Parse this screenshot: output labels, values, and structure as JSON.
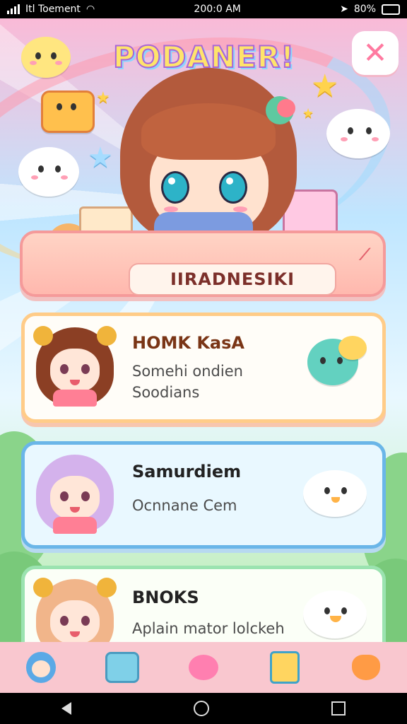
{
  "status_bar": {
    "carrier": "Itl Toement",
    "time": "200:0 AM",
    "battery": "80%"
  },
  "header": {
    "app_title": "PODANER",
    "title_exclaim": "!",
    "close_icon": "close-icon"
  },
  "banner": {
    "label": "IIRADNESIKI"
  },
  "cards": [
    {
      "title": "HOMK KasA",
      "lines": [
        "Somehi ondien",
        "Soodians"
      ],
      "title_color": "#7a3516",
      "avatar_hair": "#8b3f24"
    },
    {
      "title": "Samurdiem",
      "lines": [
        "Ocnnane Cem"
      ],
      "title_color": "#222222",
      "avatar_hair": "#d4b2ec"
    },
    {
      "title": "BNOKS",
      "lines": [
        "Aplain mator lolckeh"
      ],
      "title_color": "#222222",
      "avatar_hair": "#f1b58a"
    }
  ],
  "bottom_nav": [
    "girl-icon",
    "cup-icon",
    "bunny-icon",
    "note-icon",
    "fox-icon"
  ]
}
